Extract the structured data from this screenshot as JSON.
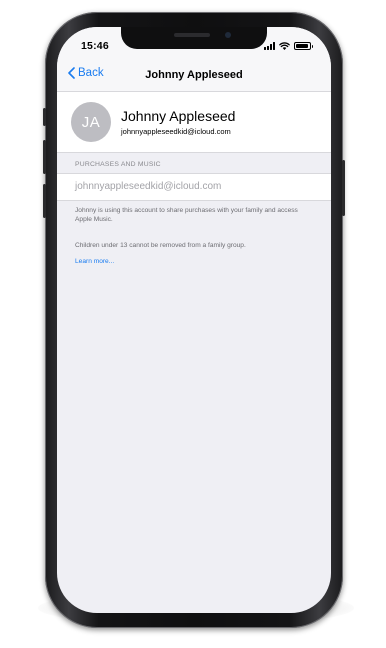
{
  "status_bar": {
    "time": "15:46",
    "icons": [
      "cellular-signal-icon",
      "wifi-icon",
      "battery-icon"
    ]
  },
  "nav": {
    "back_label": "Back",
    "title": "Johnny Appleseed"
  },
  "profile": {
    "initials": "JA",
    "name": "Johnny Appleseed",
    "email": "johnnyappleseedkid@icloud.com"
  },
  "purchases_section": {
    "header": "PURCHASES AND MUSIC",
    "account_value": "johnnyappleseedkid@icloud.com",
    "note": "Johnny is using this account to share purchases with your family and access Apple Music."
  },
  "removal_note": "Children under 13 cannot be removed from a family group.",
  "learn_more_label": "Learn more...",
  "colors": {
    "accent": "#1a7cf0",
    "screen_background": "#efeff4",
    "avatar": "#bdbdc2",
    "secondary_text": "#6d6d72",
    "frame": "#141416"
  }
}
